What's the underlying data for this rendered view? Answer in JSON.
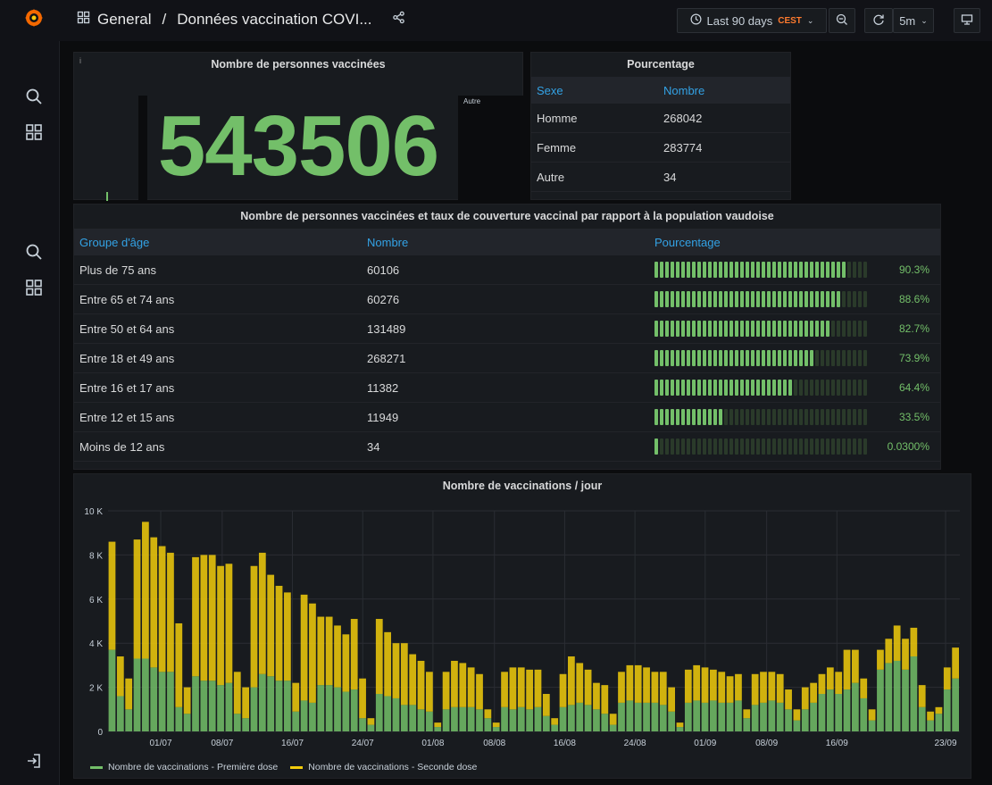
{
  "header": {
    "breadcrumb_root": "General",
    "separator": "/",
    "dashboard_title": "Données vaccination COVI...",
    "time_range": "Last 90 days",
    "timezone": "CEST",
    "refresh": "5m"
  },
  "icons": {
    "logo": "grafana-logo",
    "search": "search-icon",
    "dashboards": "dashboards-grid-icon",
    "share": "share-icon",
    "clock": "clock-icon",
    "zoom_out": "zoom-out-icon",
    "refresh": "refresh-icon",
    "tv": "tv-mode-icon",
    "signin": "sign-in-icon"
  },
  "stat_panel": {
    "title": "Nombre de personnes vaccinées",
    "value": "543506",
    "side_label": "Autre"
  },
  "sexe_table": {
    "title": "Pourcentage",
    "headers": [
      "Sexe",
      "Nombre"
    ],
    "rows": [
      [
        "Homme",
        "268042"
      ],
      [
        "Femme",
        "283774"
      ],
      [
        "Autre",
        "34"
      ]
    ]
  },
  "age_table": {
    "title": "Nombre de personnes vaccinées et taux de couverture vaccinal par rapport à la population vaudoise",
    "headers": [
      "Groupe d'âge",
      "Nombre",
      "Pourcentage"
    ],
    "rows": [
      {
        "group": "Plus de 75 ans",
        "count": "60106",
        "pct_label": "90.3%",
        "pct": 90.3
      },
      {
        "group": "Entre 65 et 74 ans",
        "count": "60276",
        "pct_label": "88.6%",
        "pct": 88.6
      },
      {
        "group": "Entre 50 et 64 ans",
        "count": "131489",
        "pct_label": "82.7%",
        "pct": 82.7
      },
      {
        "group": "Entre 18 et 49 ans",
        "count": "268271",
        "pct_label": "73.9%",
        "pct": 73.9
      },
      {
        "group": "Entre 16 et 17 ans",
        "count": "11382",
        "pct_label": "64.4%",
        "pct": 64.4
      },
      {
        "group": "Entre 12 et 15 ans",
        "count": "11949",
        "pct_label": "33.5%",
        "pct": 33.5
      },
      {
        "group": "Moins de 12 ans",
        "count": "34",
        "pct_label": "0.0300%",
        "pct": 0.03
      }
    ]
  },
  "colors": {
    "green": "#73bf69",
    "yellow": "#f2cc0c",
    "blue_header": "#33a2e5",
    "accent_orange": "#ff7a2e"
  },
  "chart_data": {
    "type": "bar",
    "stacked": true,
    "title": "Nombre de vaccinations / jour",
    "ylim": [
      0,
      10000
    ],
    "y_ticks": [
      "0",
      "2 K",
      "4 K",
      "6 K",
      "8 K",
      "10 K"
    ],
    "x_ticks": [
      "01/07",
      "08/07",
      "16/07",
      "24/07",
      "01/08",
      "08/08",
      "16/08",
      "24/08",
      "01/09",
      "08/09",
      "16/09",
      "23/09"
    ],
    "grid": true,
    "legend_position": "bottom-left",
    "series": [
      {
        "name": "Nombre de vaccinations - Première dose",
        "color": "#73bf69",
        "values": [
          3700,
          1600,
          1000,
          3300,
          3300,
          2900,
          2700,
          2700,
          1100,
          800,
          2500,
          2300,
          2300,
          2100,
          2200,
          800,
          600,
          2000,
          2600,
          2500,
          2300,
          2300,
          900,
          1400,
          1300,
          2100,
          2100,
          2000,
          1800,
          1900,
          600,
          300,
          1700,
          1600,
          1500,
          1200,
          1200,
          1000,
          900,
          200,
          1000,
          1100,
          1100,
          1100,
          1000,
          600,
          200,
          1100,
          1000,
          1100,
          1000,
          1100,
          700,
          300,
          1100,
          1200,
          1300,
          1200,
          1000,
          800,
          300,
          1300,
          1400,
          1300,
          1300,
          1300,
          1200,
          900,
          200,
          1300,
          1400,
          1300,
          1400,
          1300,
          1300,
          1400,
          600,
          1200,
          1300,
          1400,
          1300,
          1000,
          500,
          1000,
          1300,
          1700,
          1900,
          1700,
          1900,
          2200,
          1500,
          500,
          2800,
          3100,
          3200,
          2800,
          3400,
          1100,
          500,
          800,
          1900,
          2400
        ]
      },
      {
        "name": "Nombre de vaccinations - Seconde dose",
        "color": "#f2cc0c",
        "values": [
          4900,
          1800,
          1400,
          5400,
          6200,
          5900,
          5700,
          5400,
          3800,
          1200,
          5400,
          5700,
          5700,
          5400,
          5400,
          1900,
          1400,
          5500,
          5500,
          4600,
          4300,
          4000,
          1300,
          4800,
          4500,
          3100,
          3100,
          2800,
          2600,
          3200,
          1800,
          300,
          3400,
          2900,
          2500,
          2800,
          2300,
          2200,
          1800,
          200,
          1700,
          2100,
          2000,
          1800,
          1600,
          400,
          200,
          1600,
          1900,
          1800,
          1800,
          1700,
          1000,
          300,
          1500,
          2200,
          1800,
          1600,
          1200,
          1300,
          500,
          1400,
          1600,
          1700,
          1600,
          1400,
          1500,
          1100,
          200,
          1500,
          1600,
          1600,
          1400,
          1400,
          1200,
          1200,
          400,
          1400,
          1400,
          1300,
          1300,
          900,
          500,
          1000,
          900,
          900,
          1000,
          1000,
          1800,
          1500,
          900,
          500,
          900,
          1100,
          1600,
          1400,
          1300,
          1000,
          400,
          300,
          1000,
          1400
        ]
      }
    ],
    "legend": [
      "Nombre de vaccinations - Première dose",
      "Nombre de vaccinations - Seconde dose"
    ]
  }
}
